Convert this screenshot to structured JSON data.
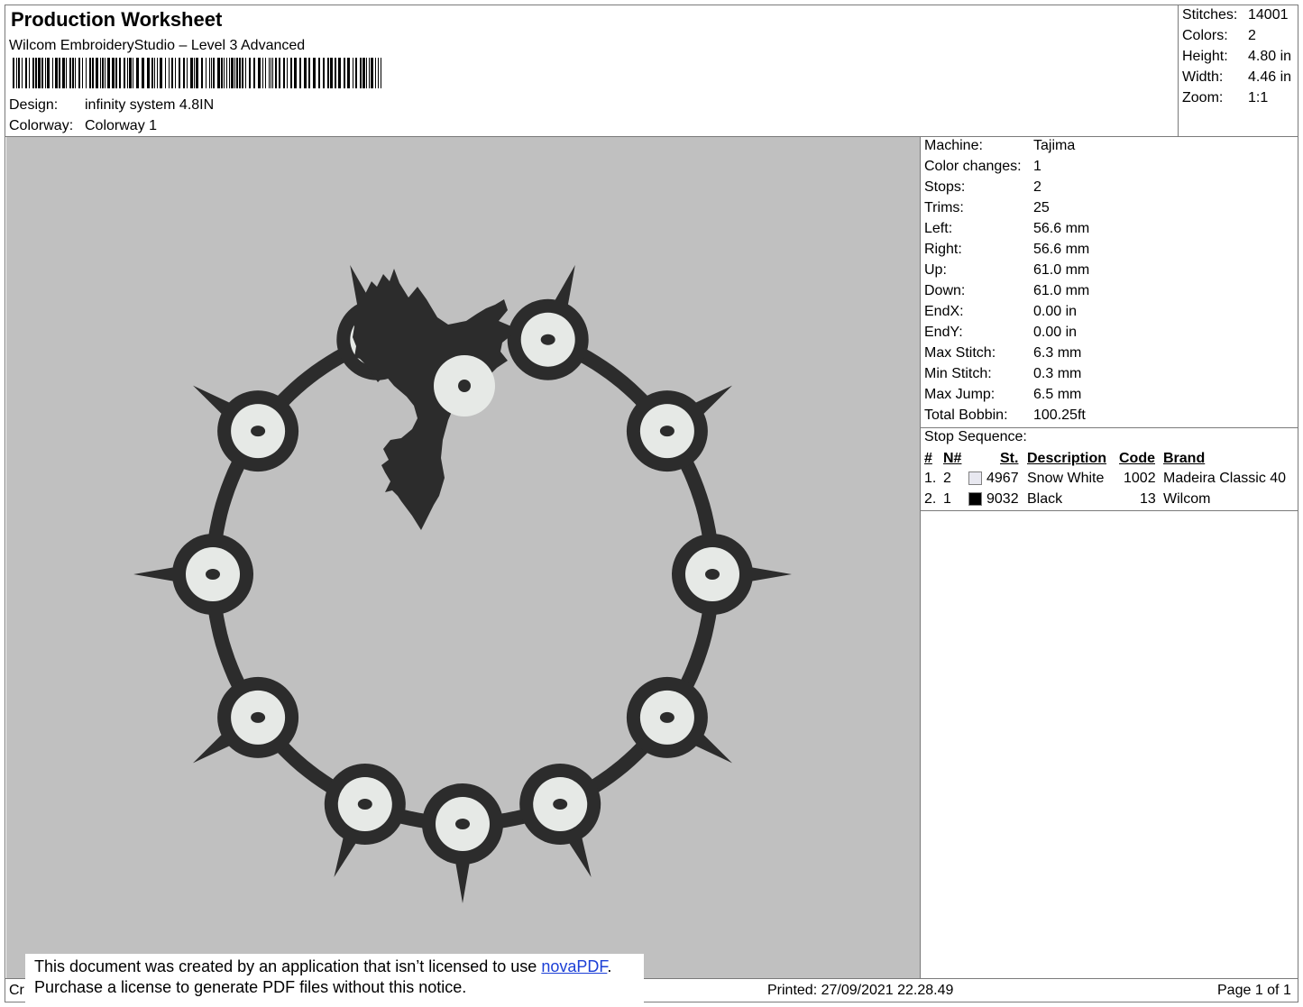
{
  "header": {
    "title": "Production Worksheet",
    "software": "Wilcom EmbroideryStudio – Level 3 Advanced",
    "design_label": "Design:",
    "design_value": "infinity system 4.8IN",
    "colorway_label": "Colorway:",
    "colorway_value": "Colorway 1"
  },
  "summary": [
    {
      "label": "Stitches:",
      "value": "14001"
    },
    {
      "label": "Colors:",
      "value": "2"
    },
    {
      "label": "Height:",
      "value": "4.80 in"
    },
    {
      "label": "Width:",
      "value": "4.46 in"
    },
    {
      "label": "Zoom:",
      "value": "1:1"
    }
  ],
  "machine_info": [
    {
      "label": "Machine:",
      "value": "Tajima"
    },
    {
      "label": "Color changes:",
      "value": "1"
    },
    {
      "label": "Stops:",
      "value": "2"
    },
    {
      "label": "Trims:",
      "value": "25"
    },
    {
      "label": "Left:",
      "value": "56.6 mm"
    },
    {
      "label": "Right:",
      "value": "56.6 mm"
    },
    {
      "label": "Up:",
      "value": "61.0 mm"
    },
    {
      "label": "Down:",
      "value": "61.0 mm"
    },
    {
      "label": "EndX:",
      "value": "0.00 in"
    },
    {
      "label": "EndY:",
      "value": "0.00 in"
    },
    {
      "label": "Max Stitch:",
      "value": "6.3 mm"
    },
    {
      "label": "Min Stitch:",
      "value": "0.3 mm"
    },
    {
      "label": "Max Jump:",
      "value": "6.5 mm"
    },
    {
      "label": "Total Bobbin:",
      "value": "100.25ft"
    }
  ],
  "stop_sequence": {
    "title": "Stop Sequence:",
    "headers": {
      "num": "#",
      "n": "N#",
      "st": "St.",
      "description": "Description",
      "code": "Code",
      "brand": "Brand"
    },
    "rows": [
      {
        "num": "1.",
        "n": "2",
        "swatch": "#e8e8f0",
        "st": "4967",
        "description": "Snow White",
        "code": "1002",
        "brand": "Madeira Classic 40"
      },
      {
        "num": "2.",
        "n": "1",
        "swatch": "#000000",
        "st": "9032",
        "description": "Black",
        "code": "13",
        "brand": "Wilcom"
      }
    ]
  },
  "footer": {
    "created_prefix": "Cr",
    "printed": "Printed: 27/09/2021 22.28.49",
    "page": "Page 1 of 1"
  },
  "notice": {
    "line1_prefix": "This document was created by an application that isn’t licensed to use ",
    "link": "novaPDF",
    "line1_suffix": ".",
    "line2": "Purchase a license to generate PDF files without this notice."
  },
  "colors": {
    "preview_bg": "#c0c0c0",
    "thread_black": "#2c2c2c",
    "thread_white": "#e6e9e6"
  }
}
